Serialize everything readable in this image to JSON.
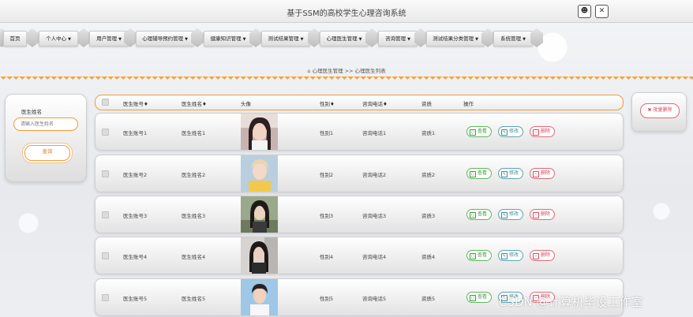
{
  "window": {
    "title": "基于SSM的高校学生心理咨询系统"
  },
  "nav": {
    "items": [
      {
        "label": "首页",
        "dropdown": false
      },
      {
        "label": "个人中心",
        "dropdown": true
      },
      {
        "label": "用户管理",
        "dropdown": true
      },
      {
        "label": "心理辅导预约管理",
        "dropdown": true
      },
      {
        "label": "健康知识管理",
        "dropdown": true
      },
      {
        "label": "测试结果管理",
        "dropdown": true
      },
      {
        "label": "心理医生管理",
        "dropdown": true
      },
      {
        "label": "咨询管理",
        "dropdown": true
      },
      {
        "label": "测试结果分类管理",
        "dropdown": true
      },
      {
        "label": "系统管理",
        "dropdown": true
      }
    ]
  },
  "breadcrumb": {
    "home_icon": "home-icon",
    "section": "心理医生管理",
    "separator": ">>",
    "page": "心理医生列表"
  },
  "search": {
    "label": "医生姓名",
    "placeholder": "请输入医生姓名",
    "button": "查询"
  },
  "batch": {
    "delete_label": "批量删除"
  },
  "table": {
    "headers": {
      "account": "医生账号",
      "name": "医生姓名",
      "avatar": "头像",
      "gender": "性别",
      "phone": "咨询电话",
      "qualification": "资质",
      "actions": "操作"
    },
    "sort_mark": "♦",
    "actions": {
      "view": "查看",
      "edit": "修改",
      "delete": "删除"
    },
    "rows": [
      {
        "account": "医生账号1",
        "name": "医生姓名1",
        "gender": "性别1",
        "phone": "咨询电话1",
        "qualification": "资质1"
      },
      {
        "account": "医生账号2",
        "name": "医生姓名2",
        "gender": "性别2",
        "phone": "咨询电话2",
        "qualification": "资质2"
      },
      {
        "account": "医生账号3",
        "name": "医生姓名3",
        "gender": "性别3",
        "phone": "咨询电话3",
        "qualification": "资质3"
      },
      {
        "account": "医生账号4",
        "name": "医生姓名4",
        "gender": "性别4",
        "phone": "咨询电话4",
        "qualification": "资质4"
      },
      {
        "account": "医生账号5",
        "name": "医生姓名5",
        "gender": "性别5",
        "phone": "咨询电话5",
        "qualification": "资质5"
      }
    ]
  },
  "watermark": "CSDN @计算机毕设工作室",
  "colors": {
    "accent": "#f29a3a",
    "view": "#5cb85c",
    "edit": "#5aa6b0",
    "delete": "#e06a7a"
  }
}
